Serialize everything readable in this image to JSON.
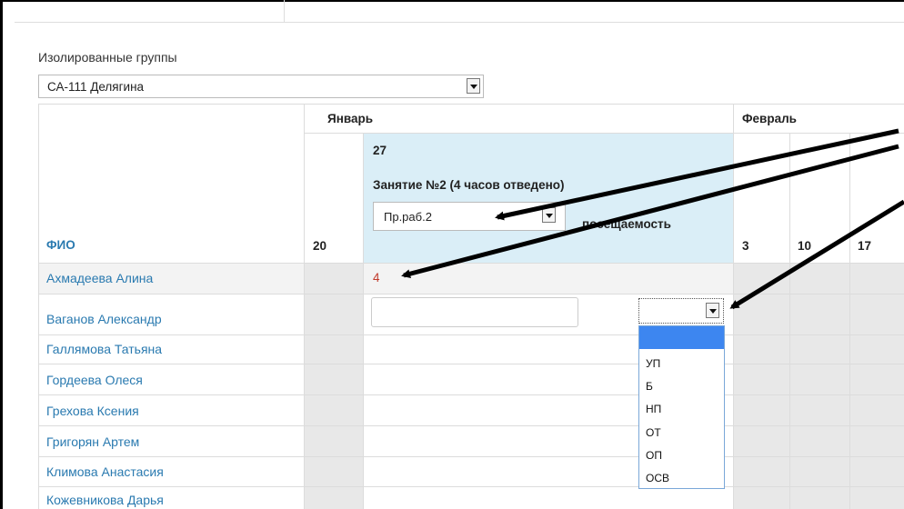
{
  "group": {
    "label": "Изолированные группы",
    "selected": "СА-111 Делягина"
  },
  "table": {
    "fio_header": "ФИО",
    "months": [
      "Январь",
      "Февраль"
    ],
    "days": {
      "jan": [
        "20",
        "27"
      ],
      "feb": [
        "3",
        "10",
        "17"
      ]
    },
    "lesson": {
      "title": "Занятие №2 (4 часов отведено)",
      "type_selected": "Пр.раб.2",
      "attendance_label": "посещаемость"
    },
    "students": [
      "Ахмадеева Алина",
      "Ваганов Александр",
      "Галлямова Татьяна",
      "Гордеева Олеся",
      "Грехова Ксения",
      "Григорян Артем",
      "Климова Анастасия",
      "Кожевникова Дарья"
    ],
    "first_mark": "4"
  },
  "attendance_dropdown": {
    "options": [
      "",
      "УП",
      "Б",
      "НП",
      "ОТ",
      "ОП",
      "ОСВ"
    ]
  }
}
